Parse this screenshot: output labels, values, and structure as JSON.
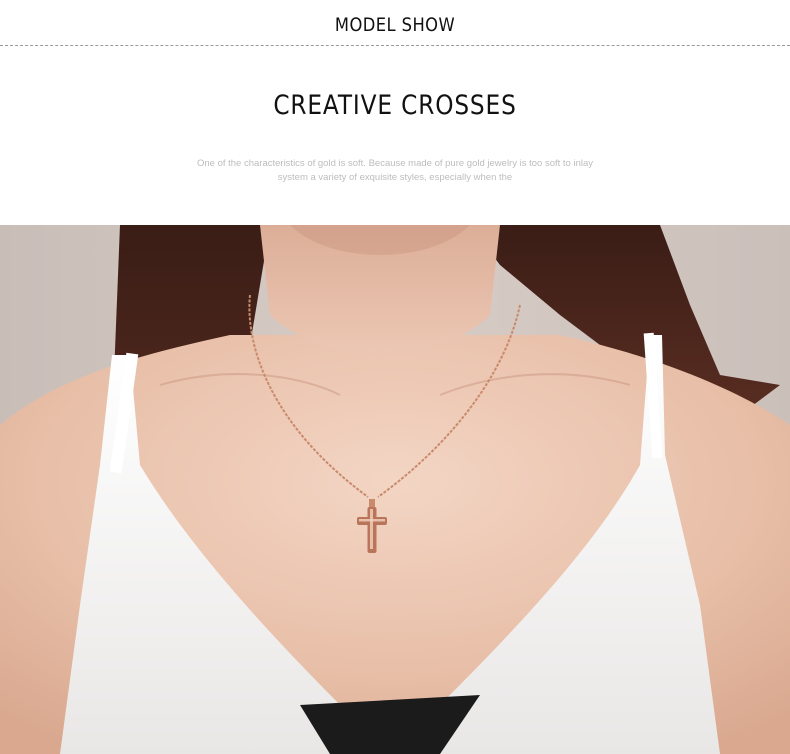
{
  "header": {
    "title": "MODEL SHOW"
  },
  "section": {
    "headline": "CREATIVE CROSSES",
    "description": "One of the characteristics of gold is soft. Because made of pure gold jewelry is too soft to inlay system a variety of exquisite styles, especially when the"
  },
  "colors": {
    "background": "#ffffff",
    "text": "#111111",
    "muted_text": "#bdbdbd",
    "rose_gold": "#c98a6c"
  },
  "photo": {
    "subject": "woman wearing rose gold cross pendant necklace and white camisole"
  }
}
